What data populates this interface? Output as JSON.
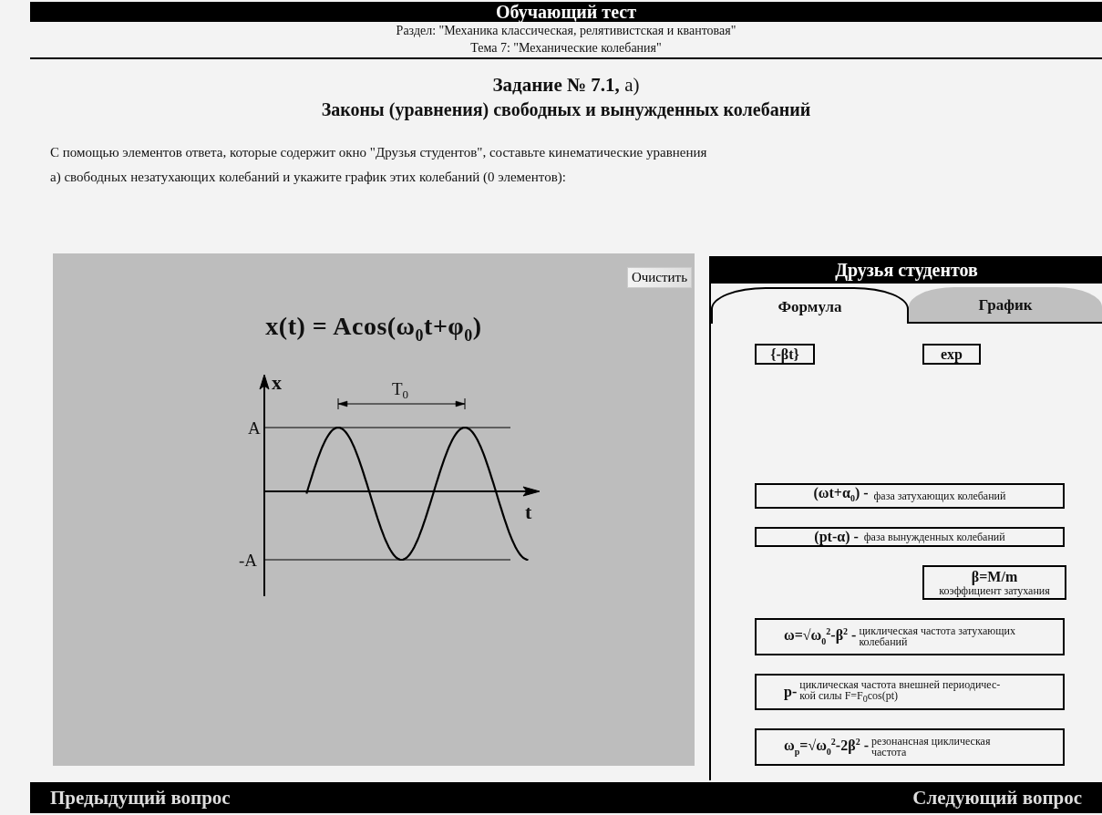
{
  "header": {
    "title": "Обучающий тест",
    "section": "Раздел: \"Механика классическая, релятивистская и квантовая\"",
    "topic": "Тема 7: \"Механические колебания\""
  },
  "task": {
    "number": "**Задание № 7.1,** а)",
    "title": "Законы (уравнения) свободных и вынужденных колебаний",
    "instruction": [
      "С помощью элементов ответа, которые содержит окно \"Друзья студентов\", составьте кинематические уравнения",
      "а) свободных незатухающих колебаний и укажите график этих колебаний (0 элементов):"
    ]
  },
  "workspace": {
    "clear_button": "Очистить",
    "equation": "x(t) = Acos(ω$_{0}$t+φ$_{0}$)",
    "graph": {
      "y_axis_label": "x",
      "x_axis_label": "t",
      "amplitude_label": "A",
      "negative_amplitude_label": "-A",
      "period_label": "T$_{0}$"
    }
  },
  "friends_panel": {
    "title": "Друзья студентов",
    "tabs": [
      {
        "label": "Формула",
        "selected": true
      },
      {
        "label": "График",
        "selected": false
      }
    ],
    "tokens": [
      "{-βt}",
      "exp"
    ],
    "items": [
      {
        "kind": "inline",
        "formula": "(ωt+α$_{0}$) -",
        "description": "фаза затухающих колебаний"
      },
      {
        "kind": "inline",
        "formula": "(pt-α) -",
        "description": "фаза вынужденных колебаний"
      },
      {
        "kind": "stacked",
        "formula": "β=M/m",
        "description": "коэффициент затухания"
      },
      {
        "kind": "wrapped",
        "formula": "ω=√ω$_{0}$$^{2}$-β$^{2}$ -",
        "description": "циклическая частота затухающих\nколебаний"
      },
      {
        "kind": "wrapped",
        "formula": "p-",
        "description": "циклическая частота внешней периодичес-\nкой силы F=F$_{0}$cos(pt)"
      },
      {
        "kind": "wrapped",
        "formula": "ω$_{p}$=√ω$_{0}$$^{2}$-2β$^{2}$ -",
        "description": "резонансная циклическая\nчастота"
      }
    ]
  },
  "navigation": {
    "previous": "Предыдущий вопрос",
    "next": "Следующий вопрос"
  }
}
